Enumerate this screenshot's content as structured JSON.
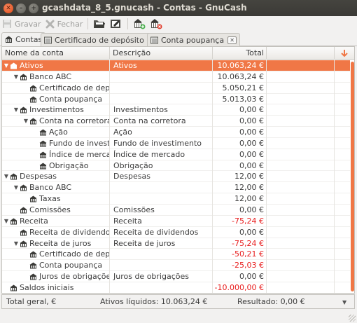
{
  "window": {
    "title": "gcashdata_8_5.gnucash - Contas - GnuCash"
  },
  "toolbar": {
    "save_label": "Gravar",
    "close_label": "Fechar"
  },
  "tabs": [
    {
      "label": "Contas",
      "active": true
    },
    {
      "label": "Certificado de depósito",
      "active": false
    },
    {
      "label": "Conta poupança",
      "active": false
    }
  ],
  "columns": {
    "name": "Nome da conta",
    "description": "Descrição",
    "total": "Total"
  },
  "accounts": [
    {
      "name": "Ativos",
      "description": "Ativos",
      "total": "10.063,24 €",
      "level": 0,
      "expander": "open",
      "negative": false,
      "selected": true
    },
    {
      "name": "Banco ABC",
      "description": "",
      "total": "10.063,24 €",
      "level": 1,
      "expander": "open",
      "negative": false,
      "selected": false
    },
    {
      "name": "Certificado de depósito",
      "description": "",
      "total": "5.050,21 €",
      "level": 2,
      "expander": "none",
      "negative": false,
      "selected": false
    },
    {
      "name": "Conta poupança",
      "description": "",
      "total": "5.013,03 €",
      "level": 2,
      "expander": "none",
      "negative": false,
      "selected": false
    },
    {
      "name": "Investimentos",
      "description": "Investimentos",
      "total": "0,00 €",
      "level": 1,
      "expander": "open",
      "negative": false,
      "selected": false
    },
    {
      "name": "Conta na corretora",
      "description": "Conta na corretora",
      "total": "0,00 €",
      "level": 2,
      "expander": "open",
      "negative": false,
      "selected": false
    },
    {
      "name": "Ação",
      "description": "Ação",
      "total": "0,00 €",
      "level": 3,
      "expander": "none",
      "negative": false,
      "selected": false
    },
    {
      "name": "Fundo de investimento",
      "description": "Fundo de investimento",
      "total": "0,00 €",
      "level": 3,
      "expander": "none",
      "negative": false,
      "selected": false
    },
    {
      "name": "Índice de mercado",
      "description": "Índice de mercado",
      "total": "0,00 €",
      "level": 3,
      "expander": "none",
      "negative": false,
      "selected": false
    },
    {
      "name": "Obrigação",
      "description": "Obrigação",
      "total": "0,00 €",
      "level": 3,
      "expander": "none",
      "negative": false,
      "selected": false
    },
    {
      "name": "Despesas",
      "description": "Despesas",
      "total": "12,00 €",
      "level": 0,
      "expander": "open",
      "negative": false,
      "selected": false
    },
    {
      "name": "Banco ABC",
      "description": "",
      "total": "12,00 €",
      "level": 1,
      "expander": "open",
      "negative": false,
      "selected": false
    },
    {
      "name": "Taxas",
      "description": "",
      "total": "12,00 €",
      "level": 2,
      "expander": "none",
      "negative": false,
      "selected": false
    },
    {
      "name": "Comissões",
      "description": "Comissões",
      "total": "0,00 €",
      "level": 1,
      "expander": "none",
      "negative": false,
      "selected": false
    },
    {
      "name": "Receita",
      "description": "Receita",
      "total": "-75,24 €",
      "level": 0,
      "expander": "open",
      "negative": true,
      "selected": false
    },
    {
      "name": "Receita de dividendos",
      "description": "Receita de dividendos",
      "total": "0,00 €",
      "level": 1,
      "expander": "none",
      "negative": false,
      "selected": false
    },
    {
      "name": "Receita de juros",
      "description": "Receita de juros",
      "total": "-75,24 €",
      "level": 1,
      "expander": "open",
      "negative": true,
      "selected": false
    },
    {
      "name": "Certificado de depósito",
      "description": "",
      "total": "-50,21 €",
      "level": 2,
      "expander": "none",
      "negative": true,
      "selected": false
    },
    {
      "name": "Conta poupança",
      "description": "",
      "total": "-25,03 €",
      "level": 2,
      "expander": "none",
      "negative": true,
      "selected": false
    },
    {
      "name": "Juros de obrigações",
      "description": "Juros de obrigações",
      "total": "0,00 €",
      "level": 2,
      "expander": "none",
      "negative": false,
      "selected": false
    },
    {
      "name": "Saldos iniciais",
      "description": "",
      "total": "-10.000,00 €",
      "level": 0,
      "expander": "none",
      "negative": true,
      "selected": false
    }
  ],
  "summary": {
    "label": "Total geral, €",
    "net_assets": "Ativos líquidos: 10.063,24 €",
    "result": "Resultado: 0,00 €"
  },
  "colors": {
    "accent": "#f07746",
    "negative": "#e81b1b"
  }
}
